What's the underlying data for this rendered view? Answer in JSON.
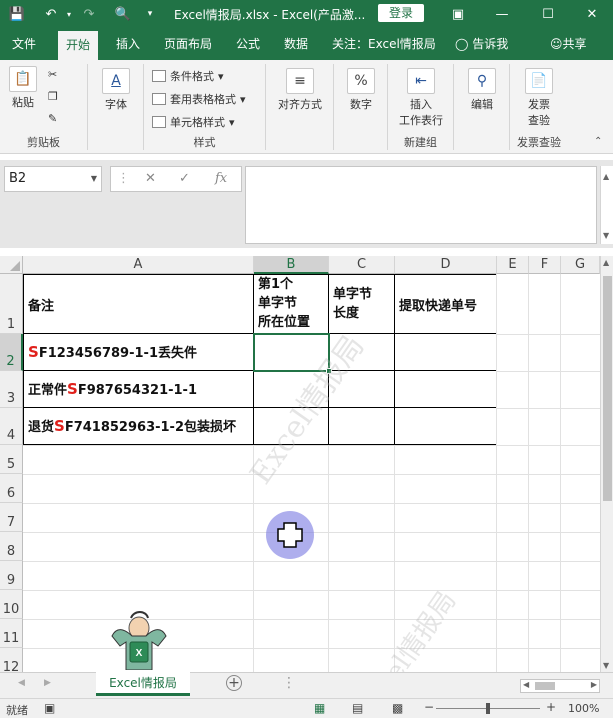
{
  "titlebar": {
    "filename": "Excel情报局.xlsx",
    "app": "Excel(产品激...",
    "login": "登录"
  },
  "menu": {
    "tabs": [
      "文件",
      "开始",
      "插入",
      "页面布局",
      "公式",
      "数据",
      "关注：Excel情报局"
    ],
    "tell_me": "告诉我",
    "share": "共享"
  },
  "ribbon": {
    "paste": "粘贴",
    "clipboard_group": "剪贴板",
    "font": "字体",
    "cond_format": "条件格式",
    "table_format": "套用表格格式",
    "cell_style": "单元格样式",
    "style_group": "样式",
    "align": "对齐方式",
    "number": "数字",
    "insert_row": "插入",
    "insert_row2": "工作表行",
    "newbuild_group": "新建组",
    "edit": "编辑",
    "invoice1": "发票",
    "invoice2": "查验",
    "invoice_group": "发票查验"
  },
  "formula": {
    "namebox": "B2",
    "fx": "fx",
    "content": ""
  },
  "columns": [
    "A",
    "B",
    "C",
    "D",
    "E",
    "F",
    "G"
  ],
  "rows": [
    "1",
    "2",
    "3",
    "4",
    "5",
    "6",
    "7",
    "8",
    "9",
    "10",
    "11",
    "12"
  ],
  "cells": {
    "a1": "备注",
    "b1_1": "第1个",
    "b1_2": "单字节",
    "b1_3": "所在位置",
    "c1_1": "单字节",
    "c1_2": "长度",
    "d1": "提取快递单号",
    "a2_pre": "",
    "a2_s": "S",
    "a2_post": "F123456789-1-1丢失件",
    "a3_pre": "正常件",
    "a3_s": "S",
    "a3_post": "F987654321-1-1",
    "a4_pre": "退货",
    "a4_s": "S",
    "a4_post": "F741852963-1-2包装损坏"
  },
  "watermark": "Excel情报局",
  "sheet": {
    "tab": "Excel情报局"
  },
  "status": {
    "ready": "就绪",
    "zoom": "100%"
  }
}
